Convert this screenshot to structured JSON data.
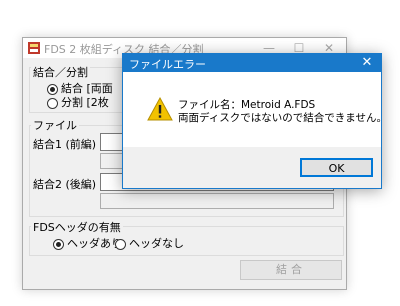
{
  "main_window": {
    "title": "FDS 2 枚組ディスク 結合／分割",
    "minimize_glyph": "—",
    "maximize_glyph": "☐",
    "close_glyph": "✕",
    "mode_group_label": "結合／分割",
    "mode_options": [
      {
        "label": "結合 [両面",
        "selected": true
      },
      {
        "label": "分割 [2枚",
        "selected": false
      }
    ],
    "file_group_label": "ファイル",
    "merge1_label": "結合1 (前編)",
    "merge2_label": "結合2 (後編)",
    "header_group_label": "FDSヘッダの有無",
    "header_options": [
      {
        "label": "ヘッダあり",
        "selected": true
      },
      {
        "label": "ヘッダなし",
        "selected": false
      }
    ],
    "action_button": "結合"
  },
  "dialog": {
    "title": "ファイルエラー",
    "close_glyph": "✕",
    "message_line1": "ファイル名：Metroid A.FDS",
    "message_line2": "両面ディスクではないので結合できません。",
    "ok_label": "OK",
    "icon": "warning-icon"
  },
  "colors": {
    "dialog_accent": "#1979ca",
    "warning_yellow": "#f2c200"
  }
}
